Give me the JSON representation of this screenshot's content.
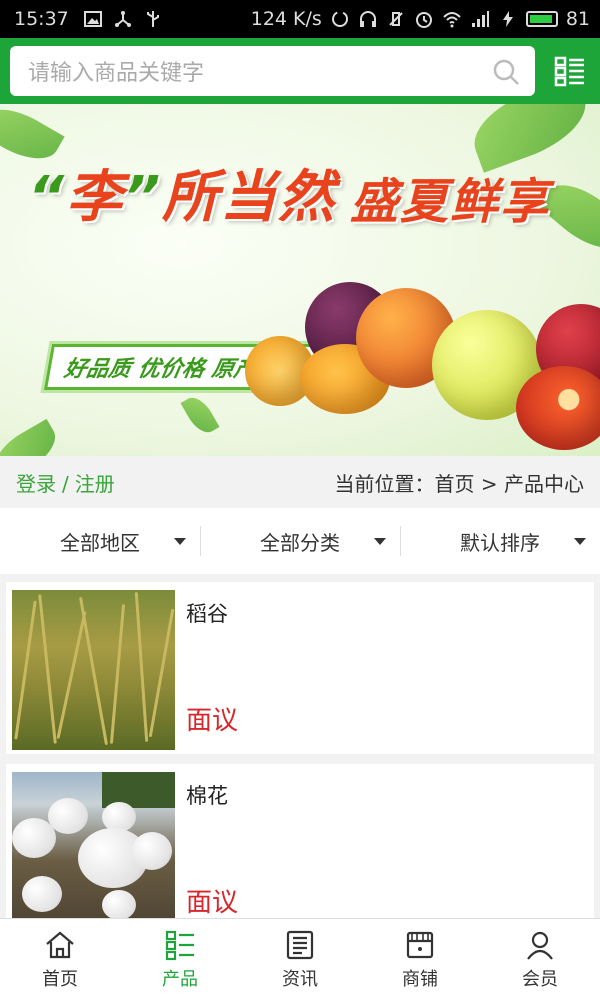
{
  "status_bar": {
    "time": "15:37",
    "speed": "124 K/s",
    "battery": "81"
  },
  "search": {
    "placeholder": "请输入商品关键字"
  },
  "banner": {
    "title_quote_open": "“",
    "title_char": "李",
    "title_quote_close": "”",
    "title_rest": "所当然",
    "title_right": "盛夏鲜享",
    "subtitle": "好品质 优价格 原产地直销"
  },
  "crumb": {
    "login": "登录",
    "separator": "/",
    "register": "注册",
    "location": "当前位置：首页 > 产品中心"
  },
  "filters": [
    {
      "label": "全部地区"
    },
    {
      "label": "全部分类"
    },
    {
      "label": "默认排序"
    }
  ],
  "products": [
    {
      "name": "稻谷",
      "price": "面议"
    },
    {
      "name": "棉花",
      "price": "面议"
    }
  ],
  "tabs": [
    {
      "label": "首页",
      "icon": "home-icon"
    },
    {
      "label": "产品",
      "icon": "list-icon"
    },
    {
      "label": "资讯",
      "icon": "news-icon"
    },
    {
      "label": "商铺",
      "icon": "shop-icon"
    },
    {
      "label": "会员",
      "icon": "user-icon"
    }
  ],
  "colors": {
    "primary": "#1ea53a",
    "price": "#d8262a",
    "link": "#3aa53a"
  }
}
